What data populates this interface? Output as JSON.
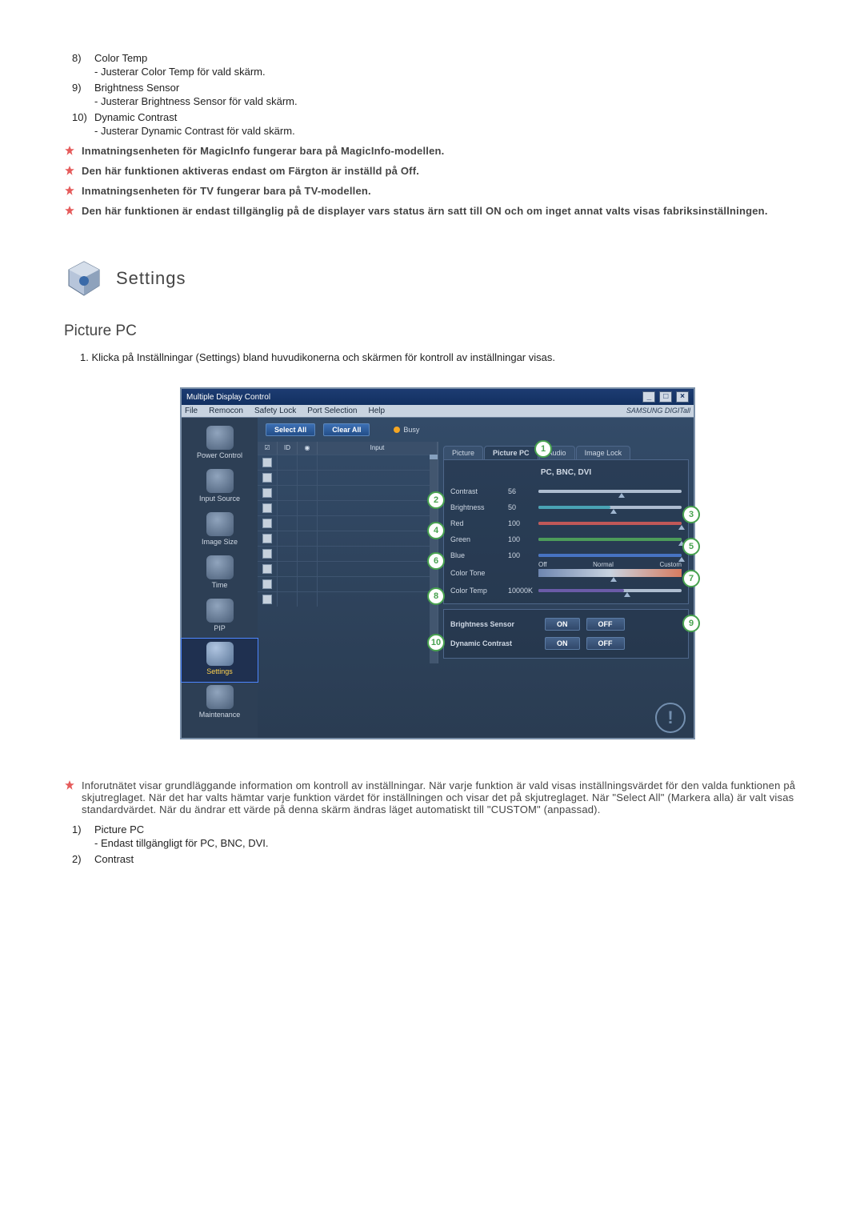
{
  "upper_list": [
    {
      "num": "8)",
      "title": "Color Temp",
      "desc": "- Justerar Color Temp för vald skärm."
    },
    {
      "num": "9)",
      "title": "Brightness Sensor",
      "desc": "- Justerar Brightness Sensor för vald skärm."
    },
    {
      "num": "10)",
      "title": "Dynamic Contrast",
      "desc": "- Justerar Dynamic Contrast för vald skärm."
    }
  ],
  "star_notes_upper": [
    "Inmatningsenheten för MagicInfo fungerar bara på MagicInfo-modellen.",
    "Den här funktionen aktiveras endast om Färgton är inställd på Off.",
    "Inmatningsenheten för TV fungerar bara på TV-modellen.",
    "Den här funktionen är endast tillgänglig på de displayer vars status ärn satt till ON och om inget annat valts visas fabriksinställningen."
  ],
  "section_title": "Settings",
  "subsection_title": "Picture PC",
  "step_line": "1. Klicka på Inställningar (Settings) bland huvudikonerna och skärmen för kontroll av inställningar visas.",
  "mdc": {
    "title": "Multiple Display Control",
    "menu": [
      "File",
      "Remocon",
      "Safety Lock",
      "Port Selection",
      "Help"
    ],
    "brand": "SAMSUNG DIGITall",
    "select_all": "Select All",
    "clear_all": "Clear All",
    "busy": "Busy",
    "head_id": "ID",
    "head_input": "Input",
    "sidebar": [
      {
        "label": "Power Control"
      },
      {
        "label": "Input Source"
      },
      {
        "label": "Image Size"
      },
      {
        "label": "Time"
      },
      {
        "label": "PIP"
      },
      {
        "label": "Settings"
      },
      {
        "label": "Maintenance"
      }
    ],
    "tabs": [
      "Picture",
      "Picture PC",
      "Audio",
      "Image Lock"
    ],
    "mode_label": "PC, BNC, DVI",
    "sliders": {
      "contrast": {
        "label": "Contrast",
        "value": "56"
      },
      "brightness": {
        "label": "Brightness",
        "value": "50"
      },
      "red": {
        "label": "Red",
        "value": "100"
      },
      "green": {
        "label": "Green",
        "value": "100"
      },
      "blue": {
        "label": "Blue",
        "value": "100"
      },
      "tone": {
        "label": "Color Tone",
        "off": "Off",
        "normal": "Normal",
        "custom": "Custom"
      },
      "color_temp": {
        "label": "Color Temp",
        "value": "10000K"
      }
    },
    "brightness_sensor": {
      "label": "Brightness Sensor",
      "on": "ON",
      "off": "OFF"
    },
    "dynamic_contrast": {
      "label": "Dynamic Contrast",
      "on": "ON",
      "off": "OFF"
    }
  },
  "star_notes_lower": [
    "Inforutnätet visar grundläggande information om kontroll av inställningar. När varje funktion är vald visas inställningsvärdet för den valda funktionen på skjutreglaget. När det har valts hämtar varje funktion värdet för inställningen och visar det på skjutreglaget. När \"Select All\" (Markera alla) är valt visas standardvärdet. När du ändrar ett värde på denna skärm ändras läget automatiskt till \"CUSTOM\" (anpassad)."
  ],
  "lower_list": [
    {
      "num": "1)",
      "title": "Picture PC",
      "desc": "- Endast tillgängligt för PC, BNC, DVI."
    },
    {
      "num": "2)",
      "title": "Contrast",
      "desc": ""
    }
  ],
  "callouts": [
    "1",
    "2",
    "3",
    "4",
    "5",
    "6",
    "7",
    "8",
    "9",
    "10"
  ]
}
